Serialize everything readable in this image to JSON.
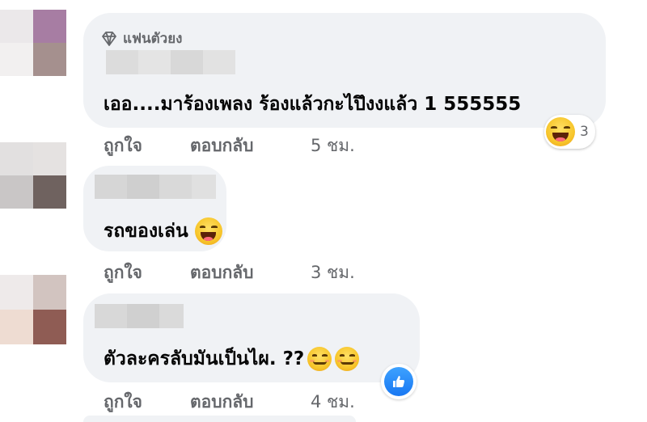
{
  "comments": [
    {
      "badge": "แฟนตัวยง",
      "text": "เออ....มาร้องเพลง ร้องแล้วกะไปึงงแล้ว 1 555555",
      "reaction": {
        "icon": "laughing-emoji-icon",
        "count": "3"
      },
      "actions": {
        "like": "ถูกใจ",
        "reply": "ตอบกลับ",
        "time": "5 ชม."
      }
    },
    {
      "text": "รถของเล่น",
      "inline_emoji": "laughing-emoji-icon",
      "actions": {
        "like": "ถูกใจ",
        "reply": "ตอบกลับ",
        "time": "3 ชม."
      }
    },
    {
      "text": "ตัวละครลับมันเป็นไผ. ??",
      "inline_emoji": "smirking-emoji-icon",
      "reaction": {
        "icon": "like-icon"
      },
      "actions": {
        "like": "ถูกใจ",
        "reply": "ตอบกลับ",
        "time": "4 ชม."
      }
    }
  ],
  "colors": {
    "bubble": "#f0f2f5",
    "meta_text": "#65676b",
    "comment_text": "#050505",
    "like_blue": "#1877f2"
  }
}
